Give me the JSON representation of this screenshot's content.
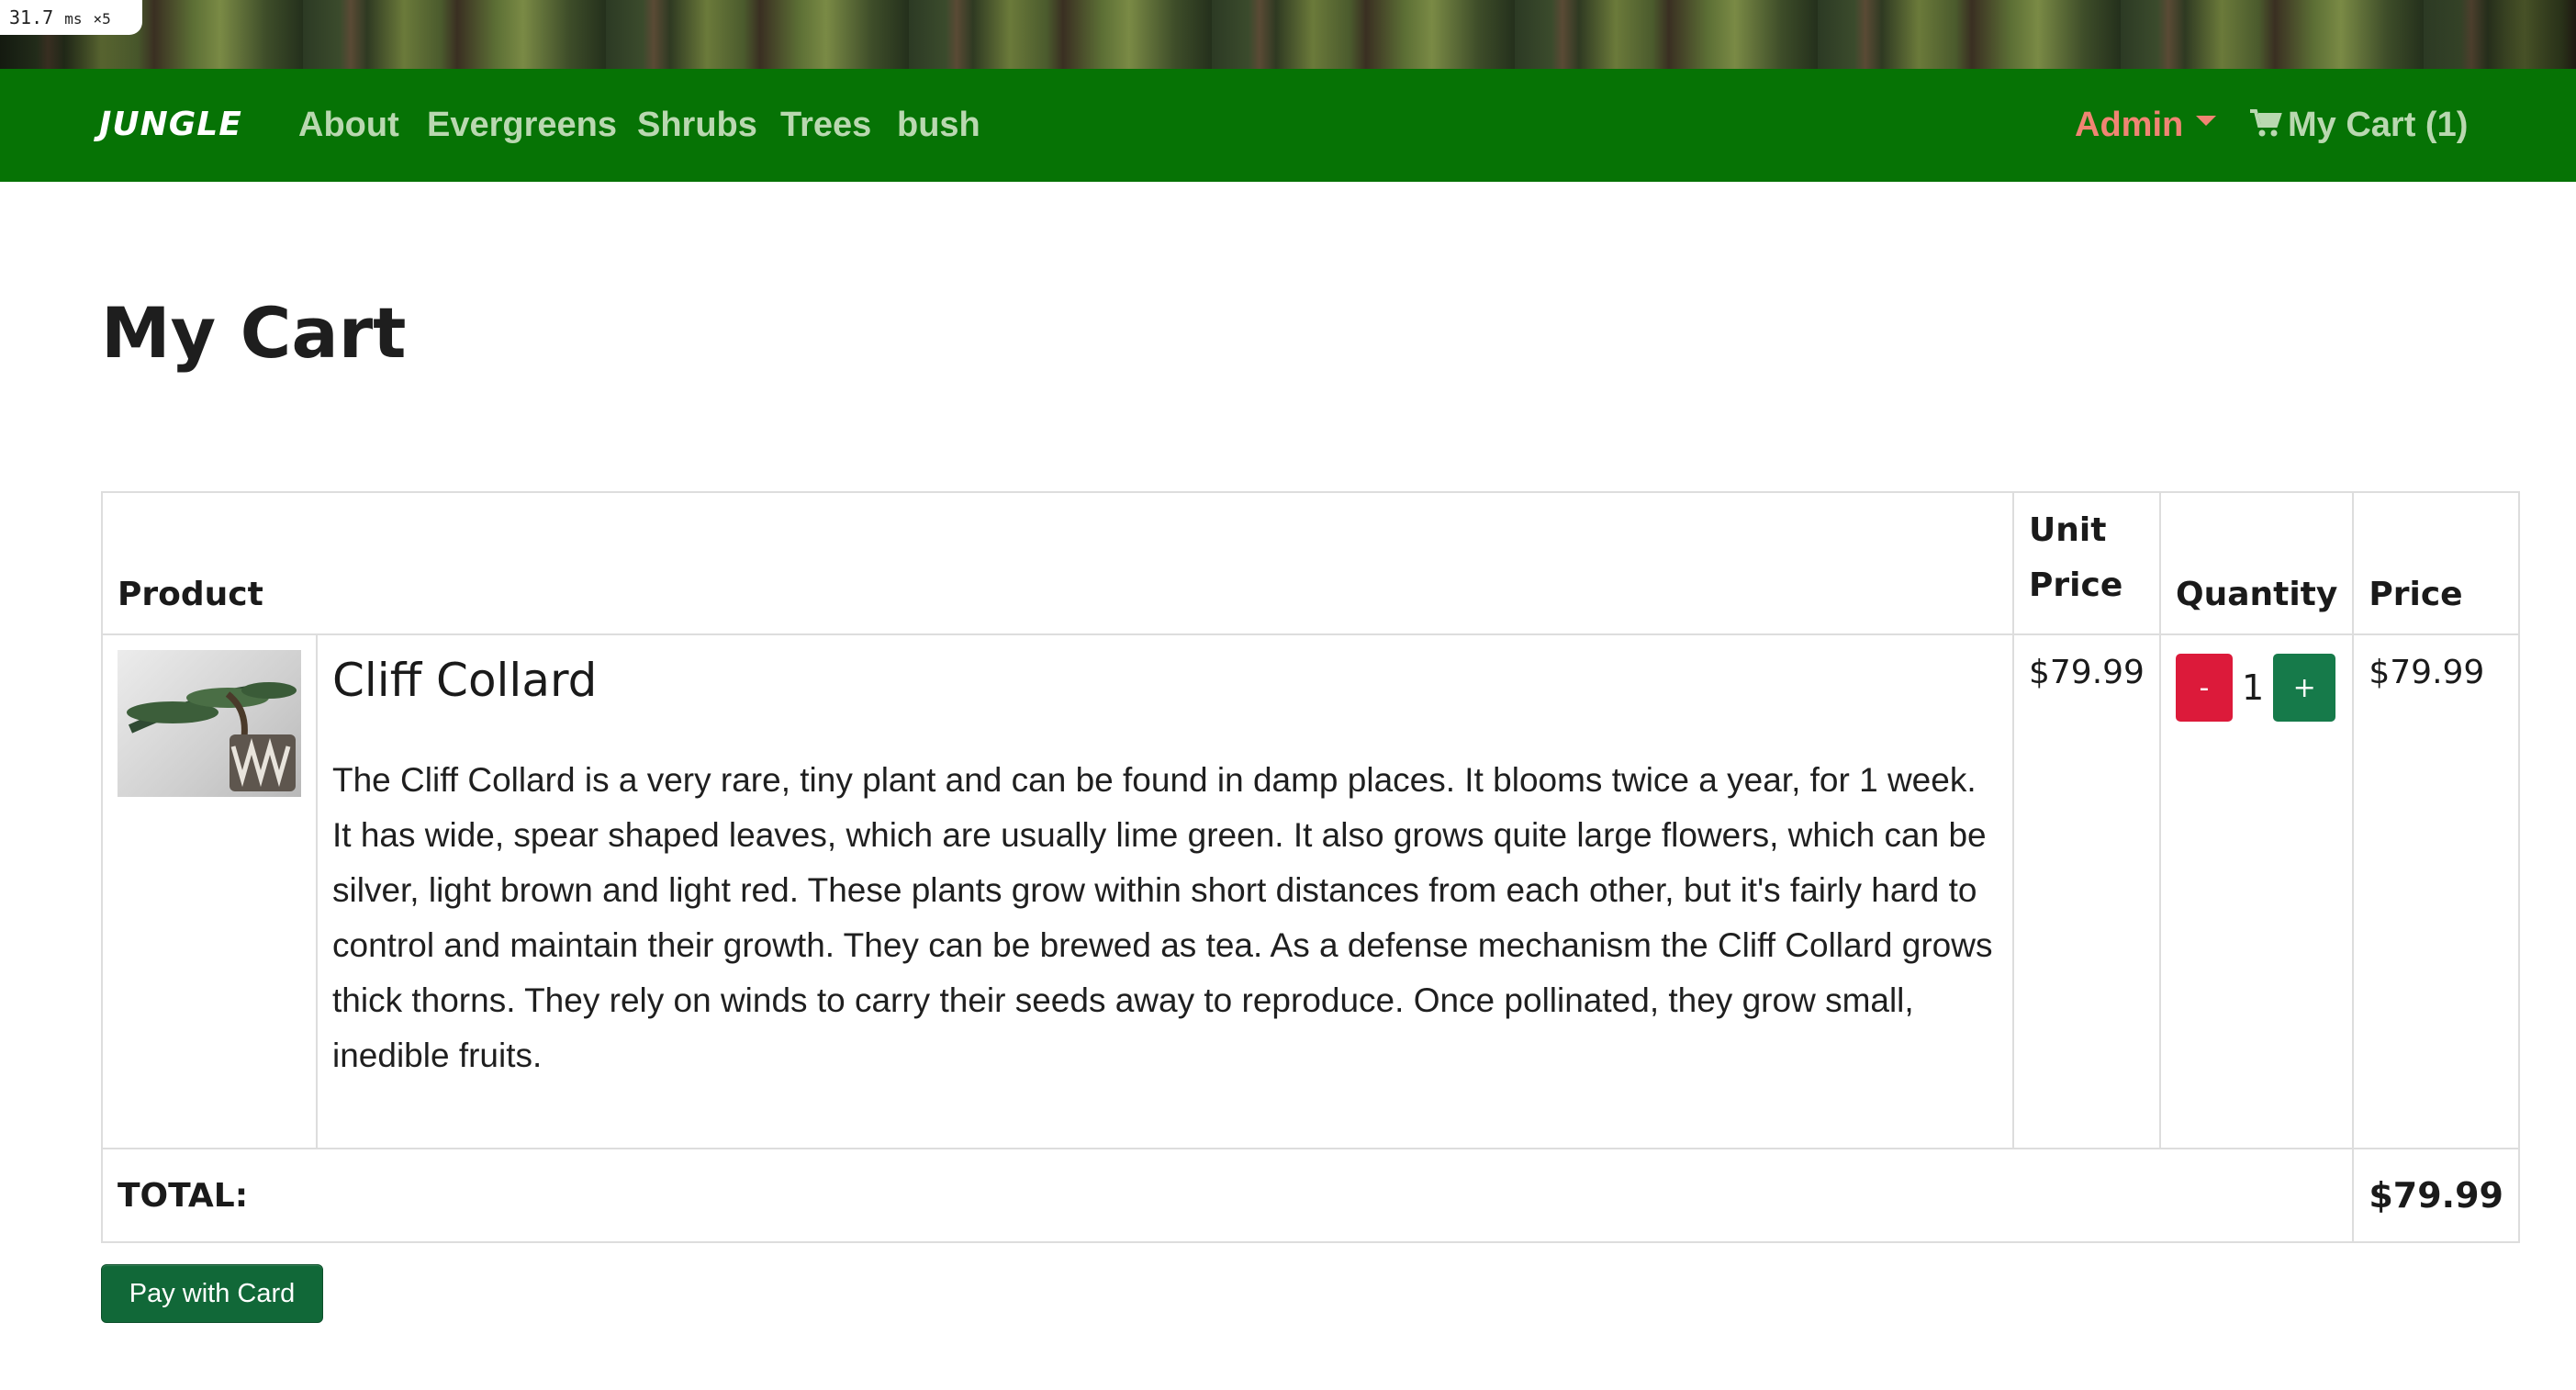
{
  "perf": {
    "value": "31.7",
    "unit": "ms",
    "suffix": "×5"
  },
  "nav": {
    "brand": "JUNGLE",
    "links": [
      "About",
      "Evergreens",
      "Shrubs",
      "Trees",
      "bush"
    ],
    "admin": "Admin",
    "cart": "My Cart (1)"
  },
  "page": {
    "title": "My Cart"
  },
  "table": {
    "headers": {
      "product": "Product",
      "unit_price": "Unit Price",
      "quantity": "Quantity",
      "price": "Price"
    },
    "rows": [
      {
        "name": "Cliff Collard",
        "description": "The Cliff Collard is a very rare, tiny plant and can be found in damp places. It blooms twice a year, for 1 week. It has wide, spear shaped leaves, which are usually lime green. It also grows quite large flowers, which can be silver, light brown and light red. These plants grow within short distances from each other, but it's fairly hard to control and maintain their growth. They can be brewed as tea. As a defense mechanism the Cliff Collard grows thick thorns. They rely on winds to carry their seeds away to reproduce. Once pollinated, they grow small, inedible fruits.",
        "unit_price": "$79.99",
        "quantity": "1",
        "minus_label": "-",
        "plus_label": "+",
        "price": "$79.99"
      }
    ],
    "total_label": "TOTAL:",
    "total_value": "$79.99"
  },
  "actions": {
    "pay_label": "Pay with Card"
  },
  "colors": {
    "navbar": "#067305",
    "admin": "#f08573",
    "minus": "#dc1a3a",
    "plus": "#167a4a",
    "pay": "#116838"
  },
  "icons": {
    "cart": "shopping-cart-icon",
    "caret": "caret-down-icon"
  }
}
